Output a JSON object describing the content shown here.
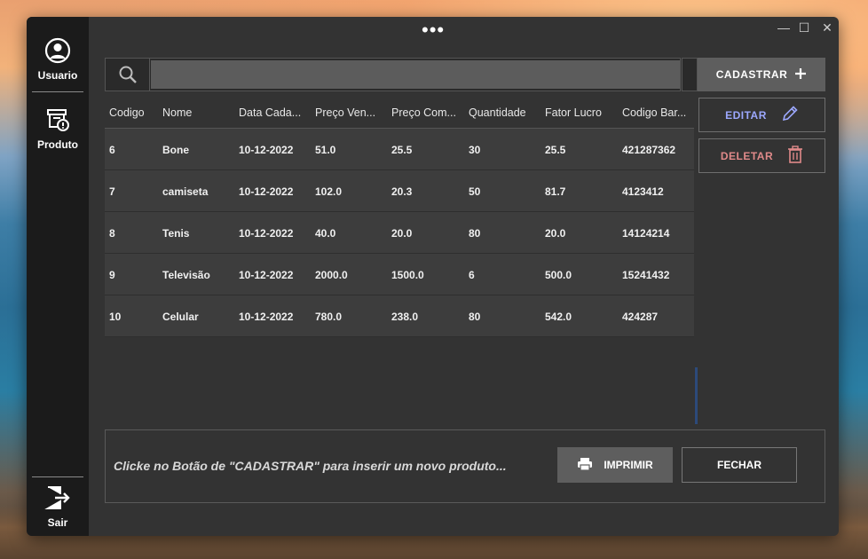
{
  "window": {
    "title_dots": "•••",
    "controls": {
      "minimize": "—",
      "maximize": "☐",
      "close": "✕"
    }
  },
  "sidebar": {
    "items": [
      {
        "label": "Usuario",
        "icon": "user-circle-icon"
      },
      {
        "label": "Produto",
        "icon": "product-box-icon"
      }
    ],
    "logout": {
      "label": "Sair",
      "icon": "logout-icon"
    }
  },
  "search": {
    "value": "",
    "placeholder": ""
  },
  "actions": {
    "cadastrar": "CADASTRAR",
    "editar": "EDITAR",
    "deletar": "DELETAR"
  },
  "table": {
    "columns": [
      "Codigo",
      "Nome",
      "Data Cada...",
      "Preço Ven...",
      "Preço Com...",
      "Quantidade",
      "Fator Lucro",
      "Codigo Bar..."
    ],
    "rows": [
      [
        "6",
        "Bone",
        "10-12-2022",
        "51.0",
        "25.5",
        "30",
        "25.5",
        "421287362"
      ],
      [
        "7",
        "camiseta",
        "10-12-2022",
        "102.0",
        "20.3",
        "50",
        "81.7",
        "4123412"
      ],
      [
        "8",
        "Tenis",
        "10-12-2022",
        "40.0",
        "20.0",
        "80",
        "20.0",
        "14124214"
      ],
      [
        "9",
        "Televisão",
        "10-12-2022",
        "2000.0",
        "1500.0",
        "6",
        "500.0",
        "15241432"
      ],
      [
        "10",
        "Celular",
        "10-12-2022",
        "780.0",
        "238.0",
        "80",
        "542.0",
        "424287"
      ]
    ]
  },
  "footer": {
    "message": "Clicke no Botão de \"CADASTRAR\" para inserir um novo produto...",
    "print_label": "IMPRIMIR",
    "close_label": "FECHAR"
  },
  "colors": {
    "window_bg": "#333333",
    "sidebar_bg": "#1b1b1b",
    "edit_accent": "#9ca8ff",
    "delete_accent": "#e08a8a",
    "scroll_accent": "#2c4a7a"
  }
}
